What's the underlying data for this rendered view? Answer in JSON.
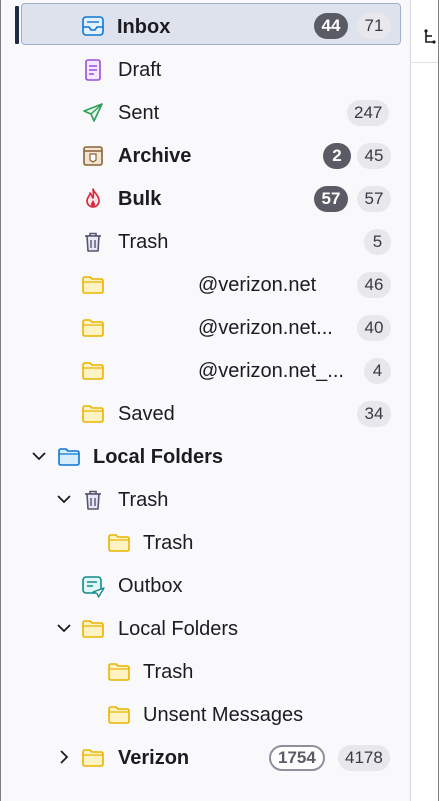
{
  "folders": [
    {
      "label": "Inbox",
      "bold": true,
      "icon": "inbox-icon",
      "unread": "44",
      "total": "71",
      "selected": true
    },
    {
      "label": "Draft",
      "bold": false,
      "icon": "draft-icon",
      "unread": null,
      "total": null
    },
    {
      "label": "Sent",
      "bold": false,
      "icon": "sent-icon",
      "unread": null,
      "total": "247"
    },
    {
      "label": "Archive",
      "bold": true,
      "icon": "archive-icon",
      "unread": "2",
      "total": "45"
    },
    {
      "label": "Bulk",
      "bold": true,
      "icon": "bulk-icon",
      "unread": "57",
      "total": "57"
    },
    {
      "label": "Trash",
      "bold": false,
      "icon": "trash-icon",
      "unread": null,
      "total": "5"
    },
    {
      "label": "@verizon.net",
      "bold": false,
      "icon": "folder-icon",
      "unread": null,
      "total": "46"
    },
    {
      "label": "@verizon.net...",
      "bold": false,
      "icon": "folder-icon",
      "unread": null,
      "total": "40"
    },
    {
      "label": "@verizon.net_...",
      "bold": false,
      "icon": "folder-icon",
      "unread": null,
      "total": "4"
    },
    {
      "label": "Saved",
      "bold": false,
      "icon": "folder-icon",
      "unread": null,
      "total": "34"
    }
  ],
  "local": {
    "account_label": "Local Folders",
    "trash_label": "Trash",
    "trash_sub_label": "Trash",
    "outbox_label": "Outbox",
    "local_folders_label": "Local Folders",
    "lf_trash_label": "Trash",
    "unsent_label": "Unsent Messages"
  },
  "verizon": {
    "label": "Verizon",
    "unread": "1754",
    "total": "4178"
  },
  "colors": {
    "selection_bg": "#dde2ec",
    "folder_yellow": "#f0c419",
    "unread_badge": "#5b5b66"
  }
}
